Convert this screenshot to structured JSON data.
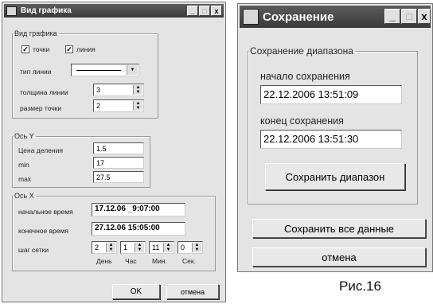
{
  "left_window": {
    "title": "Вид графика",
    "graph_group": {
      "legend": "Вид графика",
      "points_label": "точки",
      "line_label": "линия",
      "line_type_label": "тип линии",
      "line_width_label": "толщина линии",
      "line_width_value": "3",
      "point_size_label": "размер точки",
      "point_size_value": "2"
    },
    "y_group": {
      "legend": "Ось Y",
      "division_label": "Цена деления",
      "division_value": "1.5",
      "min_label": "min",
      "min_value": "17",
      "max_label": "max",
      "max_value": "27.5"
    },
    "x_group": {
      "legend": "Ось X",
      "start_label": "начальное время",
      "start_value": "17.12.06 _9:07:00",
      "end_label": "конечное время",
      "end_value": "27.12.06 15:05:00",
      "grid_step_label": "шаг сетки",
      "day_value": "2",
      "hour_value": "1",
      "min_value": "11",
      "sec_value": "0",
      "day_label": "День",
      "hour_label": "Час",
      "minute_label": "Мин.",
      "sec_label": "Сек."
    },
    "ok_label": "OK",
    "cancel_label": "отмена"
  },
  "right_window": {
    "title": "Сохранение",
    "range_group": {
      "legend": "Сохранение диапазона",
      "start_label": "начало сохранения",
      "start_value": "22.12.2006 13:51:09",
      "end_label": "конец сохранения",
      "end_value": "22.12.2006 13:51:30",
      "save_range_label": "Сохранить диапазон"
    },
    "save_all_label": "Сохранить все данные",
    "cancel_label": "отмена"
  },
  "caption": "Рис.16"
}
